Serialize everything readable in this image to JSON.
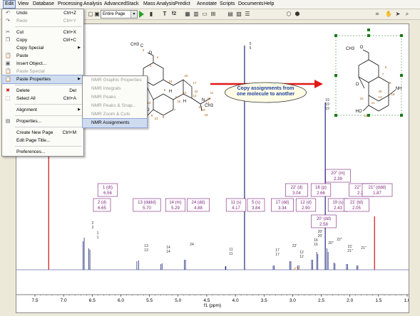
{
  "menubar": [
    "Edit",
    "View",
    "Database",
    "Processing",
    "Analysis",
    "Advanced",
    "Stack",
    "Mass Analysis",
    "Predict",
    "Annotate",
    "Scripts",
    "Documents",
    "Help"
  ],
  "toolbar": {
    "zoom_value": "Entire Page",
    "text_tool": "T",
    "f2": "f2"
  },
  "edit_menu": [
    {
      "label": "Undo",
      "shortcut": "Ctrl+Z",
      "icon": "undo-icon",
      "glyph": "↶"
    },
    {
      "label": "Redo",
      "shortcut": "Ctrl+Y",
      "icon": "redo-icon",
      "glyph": "↷",
      "dim": true
    },
    {
      "sep": true
    },
    {
      "label": "Cut",
      "shortcut": "Ctrl+X",
      "icon": "cut-icon",
      "glyph": "✂"
    },
    {
      "label": "Copy",
      "shortcut": "Ctrl+C",
      "icon": "copy-icon",
      "glyph": "❐"
    },
    {
      "label": "Copy Special",
      "sub": true
    },
    {
      "label": "Paste",
      "icon": "paste-icon",
      "glyph": "📋"
    },
    {
      "label": "Insert Object...",
      "icon": "insert-object-icon",
      "glyph": "▣"
    },
    {
      "label": "Paste Special",
      "dim": true,
      "icon": "paste-special-icon",
      "glyph": "📋"
    },
    {
      "label": "Paste Properties",
      "sub": true,
      "hl": true,
      "icon": "paste-properties-icon",
      "glyph": "📋"
    },
    {
      "sep": true
    },
    {
      "label": "Delete",
      "shortcut": "Del",
      "icon": "delete-icon",
      "glyph": "✖",
      "red": true
    },
    {
      "label": "Select All",
      "shortcut": "Ctrl+A",
      "icon": "select-all-icon",
      "glyph": "⬚"
    },
    {
      "sep": true
    },
    {
      "label": "Alignment",
      "sub": true
    },
    {
      "sep": true
    },
    {
      "label": "Properties...",
      "icon": "properties-icon",
      "glyph": "▤"
    },
    {
      "sep": true
    },
    {
      "label": "Create New Page",
      "shortcut": "Ctrl+M"
    },
    {
      "label": "Edit Page Title..."
    },
    {
      "sep": true
    },
    {
      "label": "Preferences..."
    }
  ],
  "paste_properties_submenu": [
    "NMR Graphic Properties",
    "NMR Integrals",
    "NMR Peaks",
    "NMR Peaks & Snap...",
    "NMR Zoom & Cuts",
    "NMR Assignments"
  ],
  "callout": {
    "line1": "Copy assignments from",
    "line2": "one molecule to another"
  },
  "peak_labels": [
    {
      "id": "1",
      "mult": "1 (dt)",
      "shift": "6.56"
    },
    {
      "id": "2",
      "mult": "2 (d)",
      "shift": "6.65"
    },
    {
      "id": "13",
      "mult": "13 (dddd)",
      "shift": "5.70"
    },
    {
      "id": "14",
      "mult": "14 (m)",
      "shift": "5.29"
    },
    {
      "id": "24",
      "mult": "24 (dd)",
      "shift": "4.88"
    },
    {
      "id": "11",
      "mult": "11 (s)",
      "shift": "4.17"
    },
    {
      "id": "5",
      "mult": "5 (s)",
      "shift": "3.84"
    },
    {
      "id": "17",
      "mult": "17 (dd)",
      "shift": "3.34"
    },
    {
      "id": "22p",
      "mult": "22' (d)",
      "shift": "3.04"
    },
    {
      "id": "12",
      "mult": "12 (d)",
      "shift": "2.90"
    },
    {
      "id": "16",
      "mult": "16 (p)",
      "shift": "2.66"
    },
    {
      "id": "20p",
      "mult": "20' (dd)",
      "shift": "2.58"
    },
    {
      "id": "19",
      "mult": "19 (s)",
      "shift": "2.43"
    },
    {
      "id": "20pp",
      "mult": "20'' (m)",
      "shift": "2.39"
    },
    {
      "id": "22pp",
      "mult": "22'' (m)",
      "shift": "2.28"
    },
    {
      "id": "21p",
      "mult": "21' (td)",
      "shift": "2.05"
    },
    {
      "id": "21pp",
      "mult": "21'' (ddd)",
      "shift": "1.87"
    }
  ],
  "peak_numbers": [
    "2",
    "2",
    "1",
    "1",
    "13",
    "13",
    "14",
    "14",
    "24",
    "11",
    "11",
    "5",
    "5",
    "17",
    "17",
    "22'",
    "12",
    "12",
    "16",
    "16",
    "20'",
    "20'",
    "19",
    "20''",
    "22''",
    "21'",
    "21''",
    "21''",
    "19",
    "19"
  ],
  "x_axis": {
    "label": "f1 (ppm)",
    "ticks": [
      "7.5",
      "7.0",
      "6.5",
      "6.0",
      "5.5",
      "5.0",
      "4.5",
      "4.0",
      "3.5",
      "3.0",
      "2.5",
      "2.0",
      "1.5",
      "1.0"
    ]
  },
  "molecule_left_atoms": [
    "4",
    "3",
    "2",
    "1",
    "10",
    "9",
    "8",
    "7",
    "6",
    "5",
    "24",
    "20",
    "17",
    "13",
    "14",
    "11",
    "12",
    "15",
    "16",
    "19",
    "18",
    "21",
    "22",
    "23",
    "H",
    "H",
    "N",
    "CH3",
    "HO",
    "O",
    "CH3",
    "C",
    "3"
  ],
  "molecule_right_atoms": [
    "O",
    "CH3",
    "O",
    "NH",
    "HO",
    "12",
    "11",
    "13",
    "20",
    "23",
    "18",
    "8",
    "7",
    "5"
  ],
  "colors": {
    "accent": "#1f2a7c",
    "magenta": "#7a1f7a",
    "red_peak": "#d01010",
    "callout_bg": "#fffde6"
  }
}
